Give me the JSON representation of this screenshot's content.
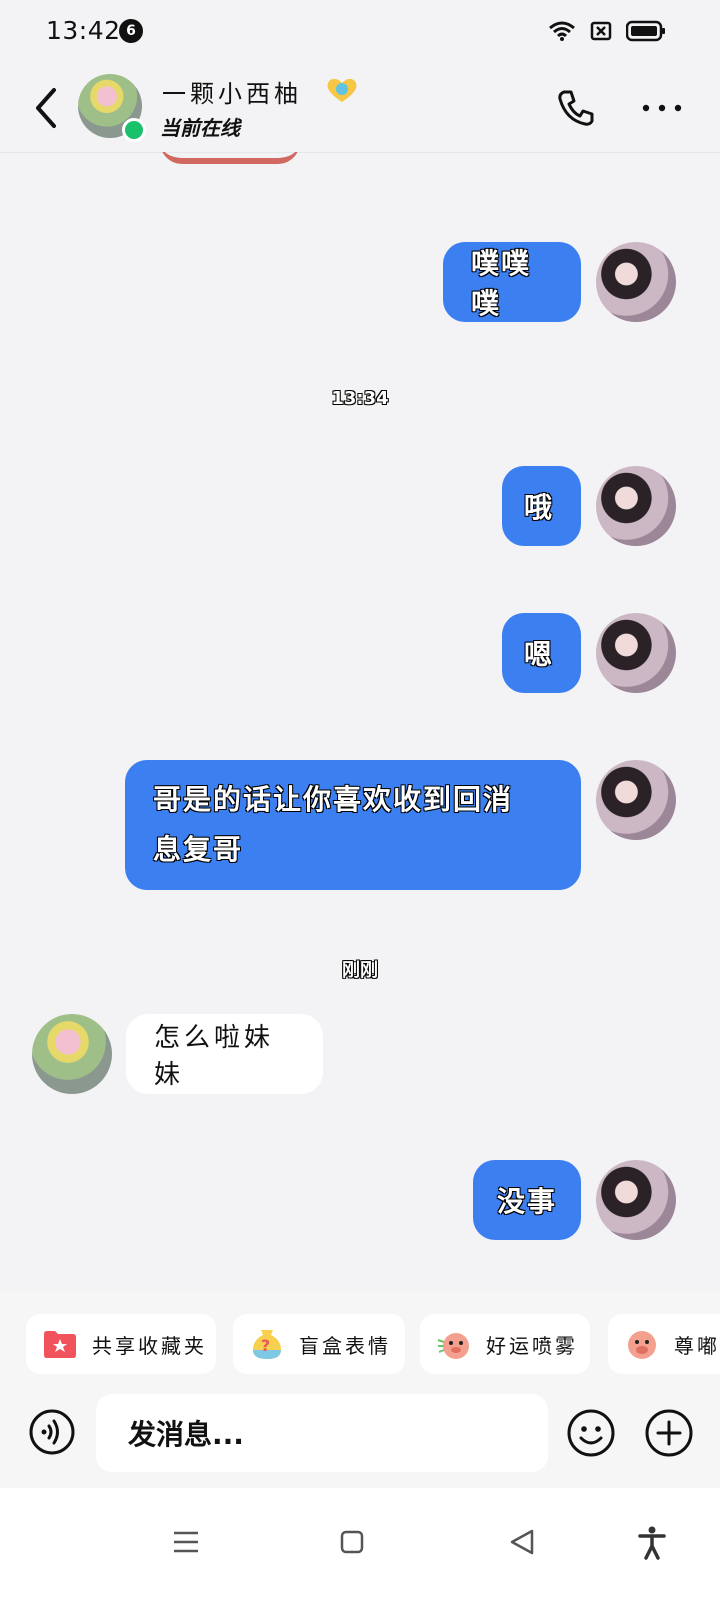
{
  "status_bar": {
    "time": "13:42",
    "notification_count": "6"
  },
  "header": {
    "contact_name": "一颗小西柚",
    "contact_status": "当前在线"
  },
  "messages": [
    {
      "side": "out",
      "text": "噗噗噗"
    },
    {
      "type": "time",
      "text": "13:34"
    },
    {
      "side": "out",
      "text": "哦"
    },
    {
      "side": "out",
      "text": "嗯"
    },
    {
      "side": "out",
      "text": "哥是的话让你喜欢收到回消息复哥"
    },
    {
      "type": "time",
      "text": "刚刚"
    },
    {
      "side": "in",
      "text": "怎么啦妹妹"
    },
    {
      "side": "out",
      "text": "没事"
    }
  ],
  "quick_actions": [
    {
      "label": "共享收藏夹",
      "icon": "folder-star-icon",
      "color": "#f0535c"
    },
    {
      "label": "盲盒表情",
      "icon": "mystery-bag-icon",
      "color": "#e85a5a"
    },
    {
      "label": "好运喷雾",
      "icon": "lucky-spray-icon",
      "color": "#f3a08e"
    },
    {
      "label": "尊嘟",
      "icon": "pig-face-icon",
      "color": "#f3a08e"
    }
  ],
  "input": {
    "placeholder": "发消息..."
  },
  "colors": {
    "outgoing_bubble": "#3b7ff0",
    "incoming_bubble": "#ffffff",
    "online": "#19c26a",
    "background": "#f3f3f5"
  }
}
